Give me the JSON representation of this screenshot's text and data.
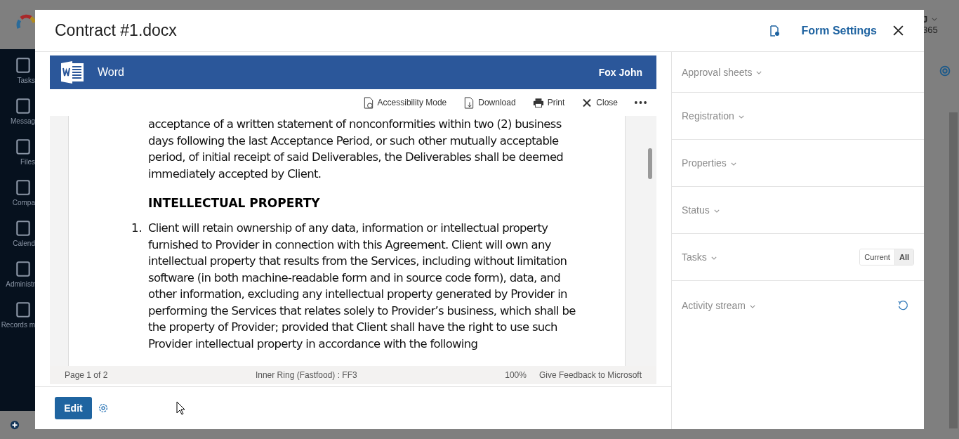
{
  "background": {
    "sidebar_items": [
      {
        "label": "Tasks"
      },
      {
        "label": "Messag"
      },
      {
        "label": "Files"
      },
      {
        "label": "Compa"
      },
      {
        "label": "Calend"
      },
      {
        "label": "Administr"
      },
      {
        "label": "Records m"
      }
    ],
    "user_initial": "J",
    "user_sub": "365"
  },
  "window": {
    "title": "Contract #1.docx",
    "form_settings": "Form Settings"
  },
  "viewer": {
    "app_name": "Word",
    "user": "Fox John",
    "toolbar": [
      {
        "label": "Accessibility Mode",
        "kind": "accessibility"
      },
      {
        "label": "Download",
        "kind": "download"
      },
      {
        "label": "Print",
        "kind": "print"
      },
      {
        "label": "Close",
        "kind": "close"
      }
    ],
    "document": {
      "intro": "acceptance of a written statement of nonconformities within two (2) business days following the last Acceptance Period, or such other mutually acceptable period, of initial receipt of said Deliverables, the Deliverables shall be deemed immediately accepted by Client.",
      "heading": "INTELLECTUAL PROPERTY",
      "items": [
        {
          "number": "1.",
          "text": "Client will retain ownership of any data, information or intellectual property furnished to Provider in connection with this Agreement. Client will own any intellectual property that results from the Services, including without limitation software (in both machine-readable form and in source code form), data, and other information, excluding any intellectual property generated by Provider in performing the Services that relates solely to Provider’s business, which shall be the property of Provider; provided that Client shall have the right to use such Provider intellectual property in accordance with the following"
        }
      ]
    },
    "status_bar": {
      "page": "Page 1 of 2",
      "ring": "Inner Ring (Fastfood) : FF3",
      "zoom": "100%",
      "feedback": "Give Feedback to Microsoft"
    }
  },
  "footer": {
    "edit": "Edit"
  },
  "sections": [
    {
      "label": "Approval sheets",
      "kind": "plain"
    },
    {
      "label": "Registration",
      "kind": "plain"
    },
    {
      "label": "Properties",
      "kind": "plain"
    },
    {
      "label": "Status",
      "kind": "plain"
    },
    {
      "label": "Tasks",
      "kind": "filter",
      "options": [
        {
          "label": "Current",
          "selected": false
        },
        {
          "label": "All",
          "selected": true
        }
      ]
    },
    {
      "label": "Activity stream",
      "kind": "refresh"
    }
  ]
}
